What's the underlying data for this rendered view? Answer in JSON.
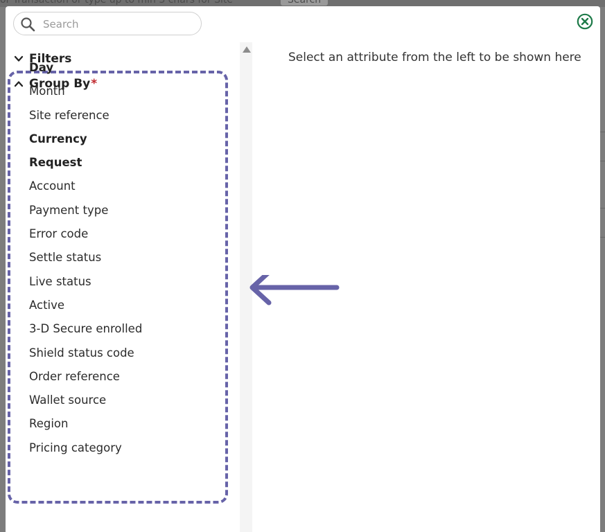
{
  "background": {
    "hint_text": "or Transaction or type up to min 3 chars for Site",
    "search_button": "Search"
  },
  "search": {
    "placeholder": "Search"
  },
  "sections": {
    "filters_label": "Filters",
    "group_by_label": "Group By",
    "required_marker": "*"
  },
  "group_by_items": [
    {
      "label": "Day",
      "selected": true
    },
    {
      "label": "Month",
      "selected": false
    },
    {
      "label": "Site reference",
      "selected": false
    },
    {
      "label": "Currency",
      "selected": true
    },
    {
      "label": "Request",
      "selected": true
    },
    {
      "label": "Account",
      "selected": false
    },
    {
      "label": "Payment type",
      "selected": false
    },
    {
      "label": "Error code",
      "selected": false
    },
    {
      "label": "Settle status",
      "selected": false
    },
    {
      "label": "Live status",
      "selected": false
    },
    {
      "label": "Active",
      "selected": false
    },
    {
      "label": "3-D Secure enrolled",
      "selected": false
    },
    {
      "label": "Shield status code",
      "selected": false
    },
    {
      "label": "Order reference",
      "selected": false
    },
    {
      "label": "Wallet source",
      "selected": false
    },
    {
      "label": "Region",
      "selected": false
    },
    {
      "label": "Pricing category",
      "selected": false
    }
  ],
  "right_pane": {
    "empty_message": "Select an attribute from the left to be shown here"
  },
  "colors": {
    "annotation": "#6763a8",
    "close_icon": "#1d7a48",
    "required": "#c0282d"
  },
  "icons": {
    "search": "search-icon",
    "close": "close-circle-icon",
    "filters_toggle": "chevron-down-icon",
    "group_by_toggle": "chevron-up-icon",
    "annotation_arrow": "arrow-left-icon"
  }
}
